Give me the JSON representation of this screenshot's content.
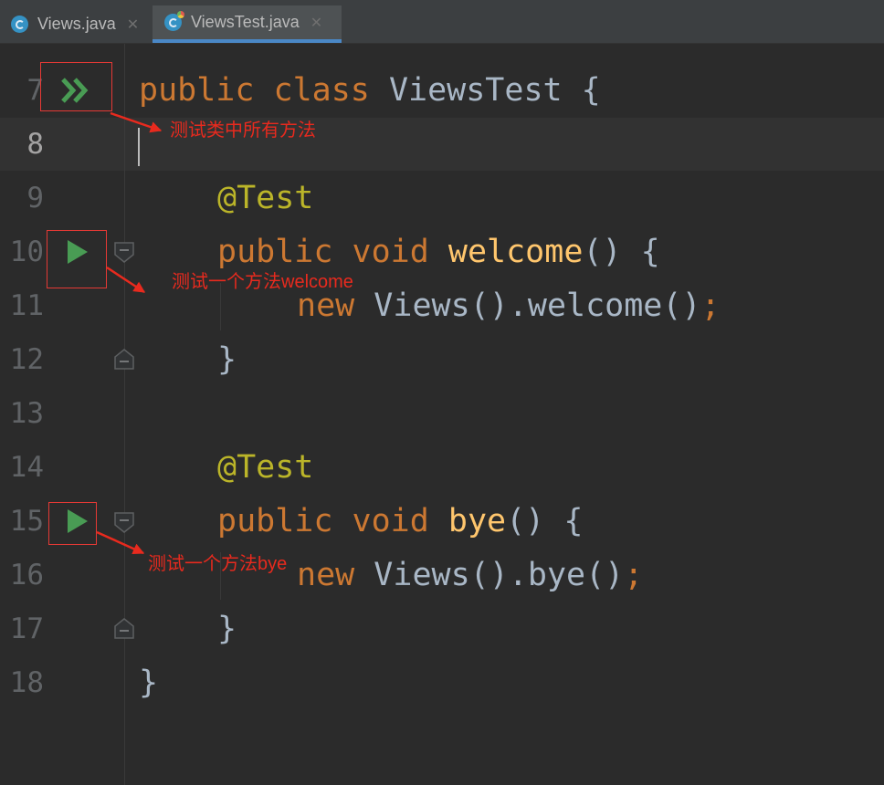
{
  "tabs": [
    {
      "label": "Views.java",
      "icon": "class-icon"
    },
    {
      "label": "ViewsTest.java",
      "icon": "test-class-icon",
      "active": true
    }
  ],
  "line_numbers": [
    "7",
    "8",
    "9",
    "10",
    "11",
    "12",
    "13",
    "14",
    "15",
    "16",
    "17",
    "18"
  ],
  "current_line": "8",
  "code": {
    "l7_kw1": "public",
    "l7_kw2": "class",
    "l7_name": "ViewsTest {",
    "l9_ann": "@Test",
    "l10_kw1": "public",
    "l10_kw2": "void",
    "l10_fn": "welcome",
    "l10_rest": "() {",
    "l11_kw": "new",
    "l11_rest": "Views().welcome()",
    "l11_semi": ";",
    "l12": "}",
    "l14_ann": "@Test",
    "l15_kw1": "public",
    "l15_kw2": "void",
    "l15_fn": "bye",
    "l15_rest": "() {",
    "l16_kw": "new",
    "l16_rest": "Views().bye()",
    "l16_semi": ";",
    "l17": "}",
    "l18": "}"
  },
  "annotations": {
    "run_all": "测试类中所有方法",
    "run_welcome": "测试一个方法welcome",
    "run_bye": "测试一个方法bye"
  },
  "colors": {
    "background": "#2b2b2b",
    "keyword": "#cc7832",
    "annotation": "#bbb529",
    "method": "#ffc66d",
    "run_icon": "#499c54",
    "annotation_red": "#e82a1e"
  }
}
